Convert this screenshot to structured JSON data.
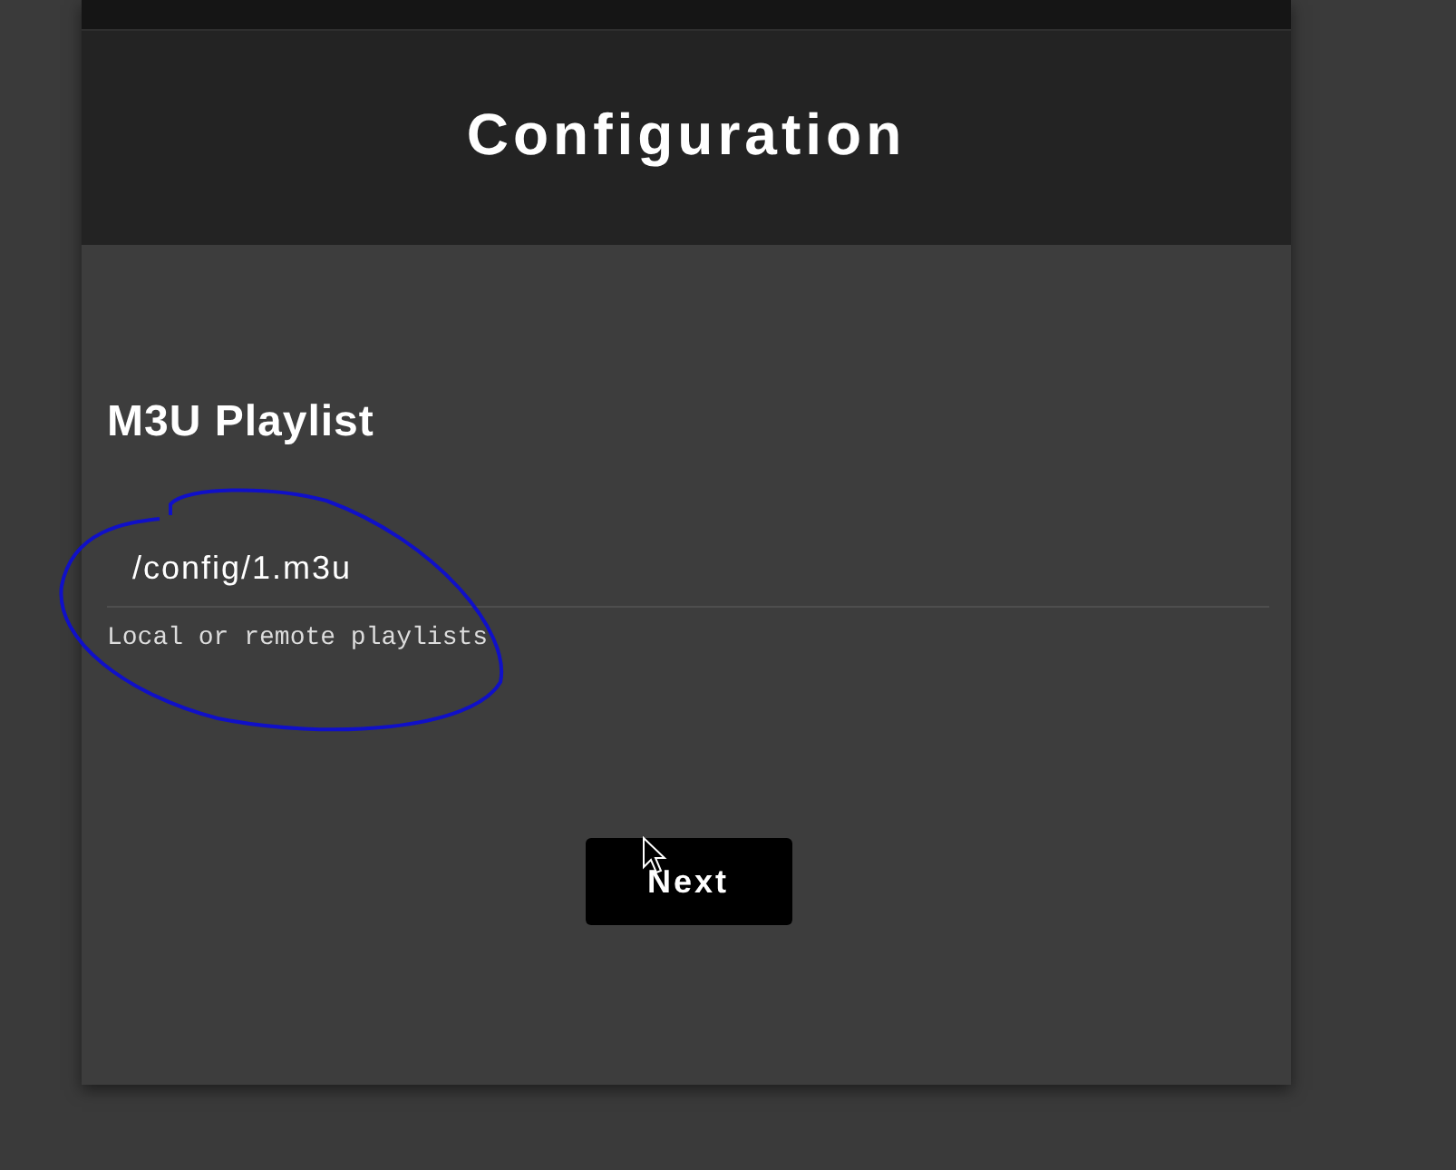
{
  "header": {
    "title": "Configuration"
  },
  "section": {
    "title": "M3U Playlist"
  },
  "playlist_field": {
    "value": "/config/1.m3u",
    "help": "Local or remote playlists"
  },
  "buttons": [
    {
      "label": "Next"
    }
  ]
}
